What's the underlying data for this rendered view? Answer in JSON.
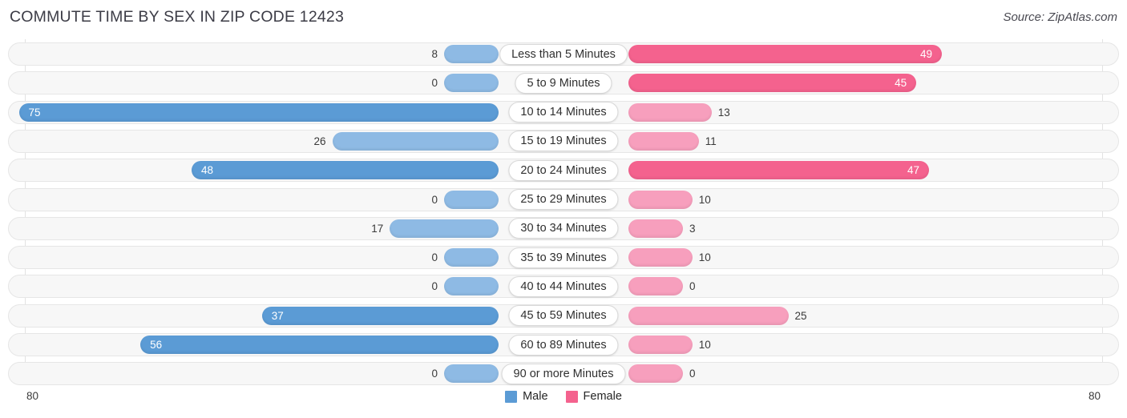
{
  "header": {
    "title": "COMMUTE TIME BY SEX IN ZIP CODE 12423",
    "source": "Source: ZipAtlas.com"
  },
  "axis": {
    "left_max": "80",
    "right_max": "80"
  },
  "legend": {
    "male_label": "Male",
    "female_label": "Female",
    "male_color": "#5b9bd5",
    "female_color": "#f4628e",
    "male_light_color": "#8ebae4",
    "female_light_color": "#f79fbd"
  },
  "chart_data": {
    "type": "bar",
    "title": "COMMUTE TIME BY SEX IN ZIP CODE 12423",
    "subtitle": "Source: ZipAtlas.com",
    "orientation": "horizontal-diverging",
    "xlabel": "",
    "ylabel": "",
    "xlim": [
      80,
      80
    ],
    "grid": true,
    "legend_position": "bottom-center",
    "categories": [
      "Less than 5 Minutes",
      "5 to 9 Minutes",
      "10 to 14 Minutes",
      "15 to 19 Minutes",
      "20 to 24 Minutes",
      "25 to 29 Minutes",
      "30 to 34 Minutes",
      "35 to 39 Minutes",
      "40 to 44 Minutes",
      "45 to 59 Minutes",
      "60 to 89 Minutes",
      "90 or more Minutes"
    ],
    "series": [
      {
        "name": "Male",
        "values": [
          8,
          0,
          75,
          26,
          48,
          0,
          17,
          0,
          0,
          37,
          56,
          0
        ]
      },
      {
        "name": "Female",
        "values": [
          49,
          45,
          13,
          11,
          47,
          10,
          3,
          10,
          0,
          25,
          10,
          0
        ]
      }
    ],
    "rows": [
      {
        "label": "Less than 5 Minutes",
        "male": 8,
        "male_text": "8",
        "female": 49,
        "female_text": "49"
      },
      {
        "label": "5 to 9 Minutes",
        "male": 0,
        "male_text": "0",
        "female": 45,
        "female_text": "45"
      },
      {
        "label": "10 to 14 Minutes",
        "male": 75,
        "male_text": "75",
        "female": 13,
        "female_text": "13"
      },
      {
        "label": "15 to 19 Minutes",
        "male": 26,
        "male_text": "26",
        "female": 11,
        "female_text": "11"
      },
      {
        "label": "20 to 24 Minutes",
        "male": 48,
        "male_text": "48",
        "female": 47,
        "female_text": "47"
      },
      {
        "label": "25 to 29 Minutes",
        "male": 0,
        "male_text": "0",
        "female": 10,
        "female_text": "10"
      },
      {
        "label": "30 to 34 Minutes",
        "male": 17,
        "male_text": "17",
        "female": 3,
        "female_text": "3"
      },
      {
        "label": "35 to 39 Minutes",
        "male": 0,
        "male_text": "0",
        "female": 10,
        "female_text": "10"
      },
      {
        "label": "40 to 44 Minutes",
        "male": 0,
        "male_text": "0",
        "female": 0,
        "female_text": "0"
      },
      {
        "label": "45 to 59 Minutes",
        "male": 37,
        "male_text": "37",
        "female": 25,
        "female_text": "25"
      },
      {
        "label": "60 to 89 Minutes",
        "male": 56,
        "male_text": "56",
        "female": 10,
        "female_text": "10"
      },
      {
        "label": "90 or more Minutes",
        "male": 0,
        "male_text": "0",
        "female": 0,
        "female_text": "0"
      }
    ]
  }
}
